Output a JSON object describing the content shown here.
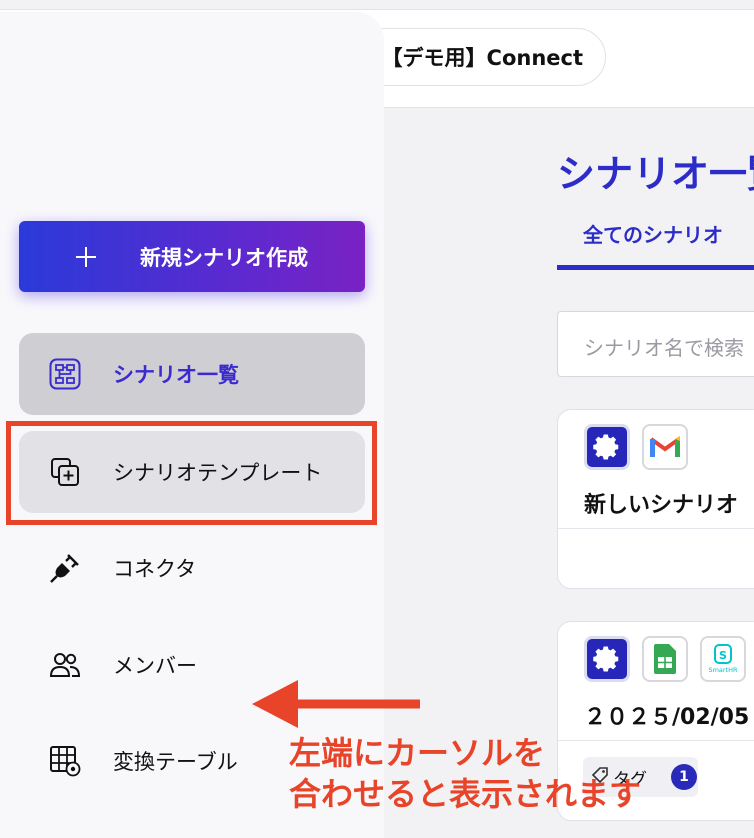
{
  "header": {
    "workspace": "【デモ用】Connect"
  },
  "main": {
    "title": "シナリオ一覧",
    "tabs": [
      {
        "label": "全てのシナリオ"
      }
    ],
    "search": {
      "placeholder": "シナリオ名で検索"
    },
    "cards": [
      {
        "name": "新しいシナリオ",
        "apps": [
          "gear-icon",
          "gmail-icon"
        ]
      },
      {
        "name": "２０２５/02/05",
        "apps": [
          "gear-icon",
          "google-sheets-icon",
          "smarthr-icon"
        ],
        "tag_label": "タグ",
        "tag_count": "1"
      }
    ]
  },
  "sidebar": {
    "new_button": "新規シナリオ作成",
    "items": [
      {
        "label": "シナリオ一覧",
        "icon": "flow-icon",
        "state": "active"
      },
      {
        "label": "シナリオテンプレート",
        "icon": "template-icon",
        "state": "hover"
      },
      {
        "label": "コネクタ",
        "icon": "plug-icon"
      },
      {
        "label": "メンバー",
        "icon": "users-icon"
      },
      {
        "label": "変換テーブル",
        "icon": "table-gear-icon"
      }
    ]
  },
  "annotation": {
    "line1": "左端にカーソルを",
    "line2": "合わせると表示されます",
    "color": "#e8442a"
  },
  "colors": {
    "accent": "#2c2cc8",
    "gradient_start": "#2a3ad8",
    "gradient_end": "#7a22c4"
  }
}
